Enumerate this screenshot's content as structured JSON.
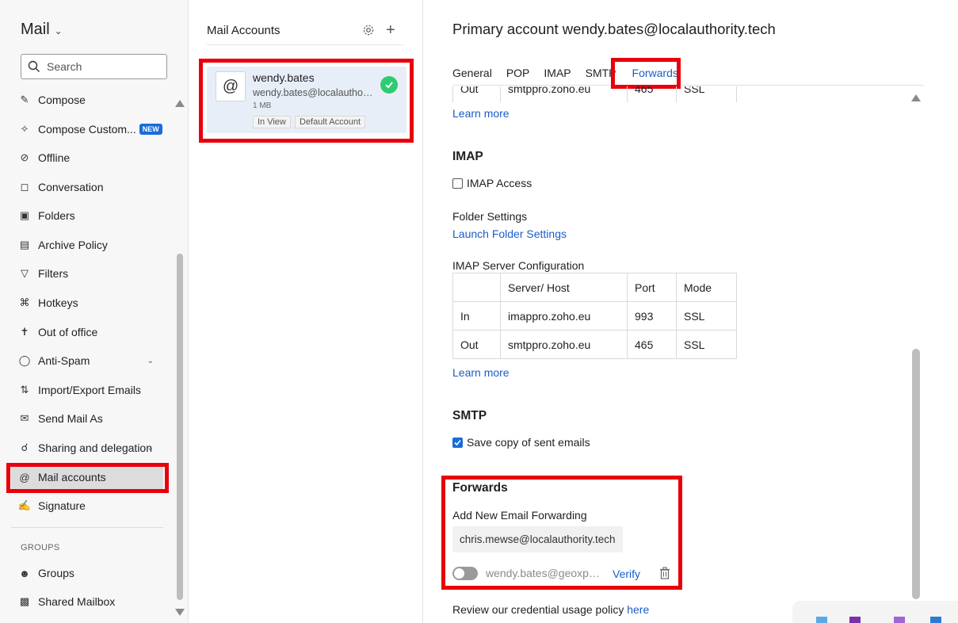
{
  "sidebar": {
    "app_title": "Mail",
    "search_placeholder": "Search",
    "items": [
      {
        "label": "Compose"
      },
      {
        "label": "Compose Custom..."
      },
      {
        "label": "Offline"
      },
      {
        "label": "Conversation"
      },
      {
        "label": "Folders"
      },
      {
        "label": "Archive Policy"
      },
      {
        "label": "Filters"
      },
      {
        "label": "Hotkeys"
      },
      {
        "label": "Out of office"
      },
      {
        "label": "Anti-Spam"
      },
      {
        "label": "Import/Export Emails"
      },
      {
        "label": "Send Mail As"
      },
      {
        "label": "Sharing and delegation"
      },
      {
        "label": "Mail accounts"
      },
      {
        "label": "Signature"
      }
    ],
    "new_badge": "NEW",
    "groups_label": "GROUPS",
    "group_items": [
      {
        "label": "Groups"
      },
      {
        "label": "Shared Mailbox"
      }
    ]
  },
  "accounts": {
    "title": "Mail Accounts",
    "card": {
      "avatar": "@",
      "name": "wendy.bates",
      "email": "wendy.bates@localauthority.tech",
      "size": "1 MB",
      "chips": [
        "In View",
        "Default Account"
      ]
    }
  },
  "main": {
    "title": "Primary account wendy.bates@localauthority.tech",
    "tabs": [
      "General",
      "POP",
      "IMAP",
      "SMTP",
      "Forwards"
    ],
    "top_row": {
      "type": "Out",
      "host": "smtppro.zoho.eu",
      "port": "465",
      "mode": "SSL"
    },
    "learn_more": "Learn more",
    "imap": {
      "heading": "IMAP",
      "access_label": "IMAP Access",
      "folder_settings_label": "Folder Settings",
      "folder_settings_link": "Launch Folder Settings",
      "server_config_label": "IMAP Server Configuration",
      "table_headers": [
        "",
        "Server/ Host",
        "Port",
        "Mode"
      ],
      "rows": [
        {
          "type": "In",
          "host": "imappro.zoho.eu",
          "port": "993",
          "mode": "SSL"
        },
        {
          "type": "Out",
          "host": "smtppro.zoho.eu",
          "port": "465",
          "mode": "SSL"
        }
      ]
    },
    "smtp": {
      "heading": "SMTP",
      "save_copy_label": "Save copy of sent emails"
    },
    "forwards": {
      "heading": "Forwards",
      "add_label": "Add New Email Forwarding",
      "input_value": "chris.mewse@localauthority.tech",
      "existing_email": "wendy.bates@geoxphe...",
      "verify_label": "Verify"
    },
    "policy_text": "Review our credential usage policy",
    "policy_link": "here"
  },
  "colors": {
    "accent": "#1a5dc8",
    "highlight_red": "#e8000b",
    "success": "#2ecc71"
  }
}
